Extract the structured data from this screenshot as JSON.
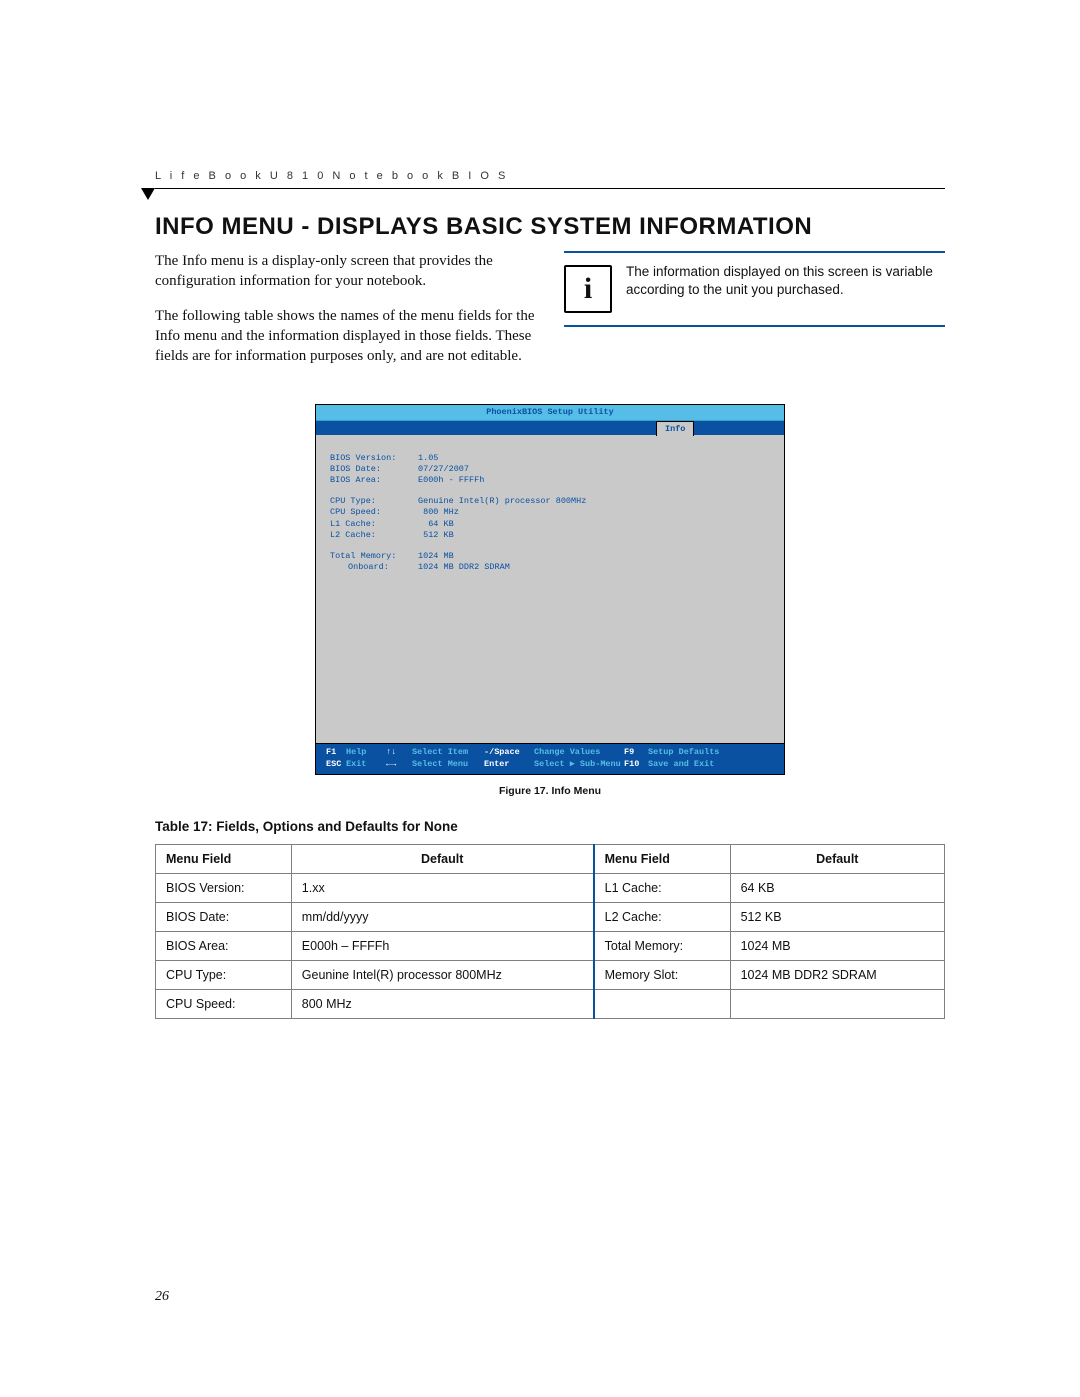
{
  "running_head": "L i f e B o o k   U 8 1 0   N o t e b o o k   B I O S",
  "section_title": "INFO MENU - DISPLAYS BASIC SYSTEM INFORMATION",
  "para1": "The Info menu is a display-only screen that provides the configuration information for your notebook.",
  "para2": "The following table shows the names of the menu fields for the Info menu and the information displayed in those fields. These fields are for information purposes only, and are not editable.",
  "note_text": "The information displayed on this screen is variable according to the unit you purchased.",
  "info_glyph": "i",
  "bios": {
    "util_title": "PhoenixBIOS Setup Utility",
    "tab": "Info",
    "fields": {
      "bios_version_lbl": "BIOS Version:",
      "bios_version_val": "1.05",
      "bios_date_lbl": "BIOS Date:",
      "bios_date_val": "07/27/2007",
      "bios_area_lbl": "BIOS Area:",
      "bios_area_val": "E000h - FFFFh",
      "cpu_type_lbl": "CPU Type:",
      "cpu_type_val": "Genuine Intel(R) processor 800MHz",
      "cpu_speed_lbl": "CPU Speed:",
      "cpu_speed_val": " 800 MHz",
      "l1_lbl": "L1 Cache:",
      "l1_val": "  64 KB",
      "l2_lbl": "L2 Cache:",
      "l2_val": " 512 KB",
      "total_mem_lbl": "Total Memory:",
      "total_mem_val": "1024 MB",
      "onboard_lbl": "Onboard:",
      "onboard_val": "1024 MB DDR2 SDRAM"
    },
    "footer": {
      "f1": "F1",
      "f1_lbl": "Help",
      "esc": "ESC",
      "esc_lbl": "Exit",
      "updn": "↑↓",
      "updn_lbl": "Select Item",
      "lr": "←→",
      "lr_lbl": "Select Menu",
      "minus": "-/Space",
      "minus_lbl": "Change Values",
      "enter": "Enter",
      "enter_lbl": "Select ▶ Sub-Menu",
      "f9": "F9",
      "f9_lbl": "Setup Defaults",
      "f10": "F10",
      "f10_lbl": "Save and Exit"
    }
  },
  "figure_caption": "Figure 17.   Info Menu",
  "table_title": "Table 17: Fields, Options and Defaults for None",
  "table_headers": {
    "menu_field": "Menu Field",
    "default": "Default"
  },
  "table_rows_left": [
    {
      "field": "BIOS Version:",
      "def": "1.xx"
    },
    {
      "field": "BIOS Date:",
      "def": "mm/dd/yyyy"
    },
    {
      "field": "BIOS Area:",
      "def": "E000h – FFFFh"
    },
    {
      "field": "CPU Type:",
      "def": "Geunine Intel(R) processor 800MHz"
    },
    {
      "field": "CPU Speed:",
      "def": "800 MHz"
    }
  ],
  "table_rows_right": [
    {
      "field": "L1 Cache:",
      "def": "64 KB"
    },
    {
      "field": "L2 Cache:",
      "def": "512 KB"
    },
    {
      "field": "Total Memory:",
      "def": "1024 MB"
    },
    {
      "field": "Memory Slot:",
      "def": "1024 MB DDR2 SDRAM"
    },
    {
      "field": "",
      "def": ""
    }
  ],
  "page_number": "26"
}
